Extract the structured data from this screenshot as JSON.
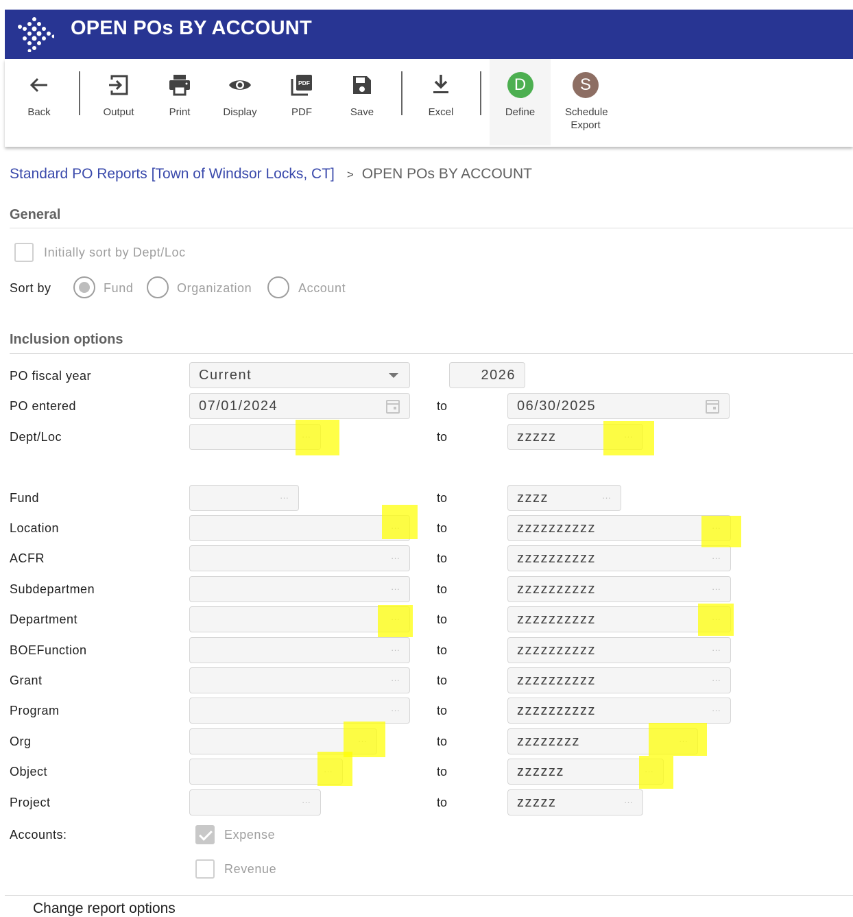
{
  "app": {
    "title": "OPEN POs BY ACCOUNT"
  },
  "toolbar": {
    "back": "Back",
    "output": "Output",
    "print": "Print",
    "display": "Display",
    "pdf": "PDF",
    "save": "Save",
    "excel": "Excel",
    "define": "Define",
    "define_initial": "D",
    "schedule": "Schedule Export",
    "schedule_initial": "S",
    "define_color": "#4caf50",
    "schedule_color": "#8d6e63"
  },
  "breadcrumb": {
    "parent": "Standard PO Reports [Town of Windsor Locks, CT]",
    "separator": ">",
    "current": "OPEN POs BY ACCOUNT"
  },
  "general": {
    "heading": "General",
    "initial_sort_label": "Initially sort by Dept/Loc",
    "initial_sort_checked": false,
    "sort_by_label": "Sort by",
    "sort_options": [
      "Fund",
      "Organization",
      "Account"
    ],
    "sort_selected": "Fund"
  },
  "inclusion": {
    "heading": "Inclusion options",
    "to_label": "to",
    "po_fiscal_year": {
      "label": "PO fiscal year",
      "select_value": "Current",
      "year": "2026"
    },
    "po_entered": {
      "label": "PO entered",
      "from": "07/01/2024",
      "to": "06/30/2025"
    },
    "rows": [
      {
        "label": "Dept/Loc",
        "from": "",
        "to": "zzzzz"
      },
      {
        "label": "Fund",
        "from": "",
        "to": "zzzz"
      },
      {
        "label": "Location",
        "from": "",
        "to": "zzzzzzzzzz"
      },
      {
        "label": "ACFR",
        "from": "",
        "to": "zzzzzzzzzz"
      },
      {
        "label": "Subdepartmen",
        "from": "",
        "to": "zzzzzzzzzz"
      },
      {
        "label": "Department",
        "from": "",
        "to": "zzzzzzzzzz"
      },
      {
        "label": "BOEFunction",
        "from": "",
        "to": "zzzzzzzzzz"
      },
      {
        "label": "Grant",
        "from": "",
        "to": "zzzzzzzzzz"
      },
      {
        "label": "Program",
        "from": "",
        "to": "zzzzzzzzzz"
      },
      {
        "label": "Org",
        "from": "",
        "to": "zzzzzzzz"
      },
      {
        "label": "Object",
        "from": "",
        "to": "zzzzzz"
      },
      {
        "label": "Project",
        "from": "",
        "to": "zzzzz"
      }
    ],
    "lookup_glyph": "···",
    "accounts": {
      "label": "Accounts:",
      "expense": "Expense",
      "expense_checked": true,
      "revenue": "Revenue",
      "revenue_checked": false
    }
  },
  "footer": {
    "change_options": "Change report options"
  },
  "highlight_color": "#ffff00"
}
